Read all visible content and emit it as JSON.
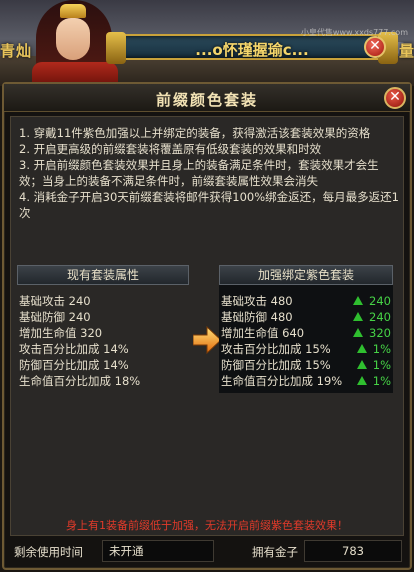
{
  "scene": {
    "left_text": "青灿",
    "right_text": "量",
    "player_name": "...o怀瑾握瑜c...",
    "watermark": "小皇代售www.xxds777.com",
    "close_glyph": "✕"
  },
  "dialog": {
    "title": "前缀颜色套装",
    "close_glyph": "✕",
    "rules": [
      "1. 穿戴11件紫色加强以上并绑定的装备，获得激活该套装效果的资格",
      "2. 开启更高级的前缀套装将覆盖原有低级套装的效果和时效",
      "3. 开启前缀颜色套装效果并且身上的装备满足条件时，套装效果才会生效；当身上的装备不满足条件时，前缀套装属性效果会消失",
      "4. 消耗金子开启30天前缀套装将邮件获得100%绑金返还，每月最多返还1次"
    ],
    "current_set": {
      "header": "现有套装属性",
      "rows": [
        "基础攻击 240",
        "基础防御 240",
        "增加生命值 320",
        "攻击百分比加成 14%",
        "防御百分比加成 14%",
        "生命值百分比加成 18%"
      ]
    },
    "upgraded_set": {
      "header": "加强绑定紫色套装",
      "rows": [
        {
          "label": "基础攻击 480",
          "bonus": "240"
        },
        {
          "label": "基础防御 480",
          "bonus": "240"
        },
        {
          "label": "增加生命值 640",
          "bonus": "320"
        },
        {
          "label": "攻击百分比加成 15%",
          "bonus": "1%"
        },
        {
          "label": "防御百分比加成 15%",
          "bonus": "1%"
        },
        {
          "label": "生命值百分比加成 19%",
          "bonus": "1%"
        }
      ],
      "bonus_color": "#46d246"
    },
    "warning": "身上有1装备前缀低于加强，无法开启前缀紫色套装效果！",
    "warning_color": "#e23a2a",
    "remaining_time_label": "剩余使用时间",
    "remaining_time_value": "未开通",
    "gold_label": "拥有金子",
    "gold_value": "783"
  }
}
